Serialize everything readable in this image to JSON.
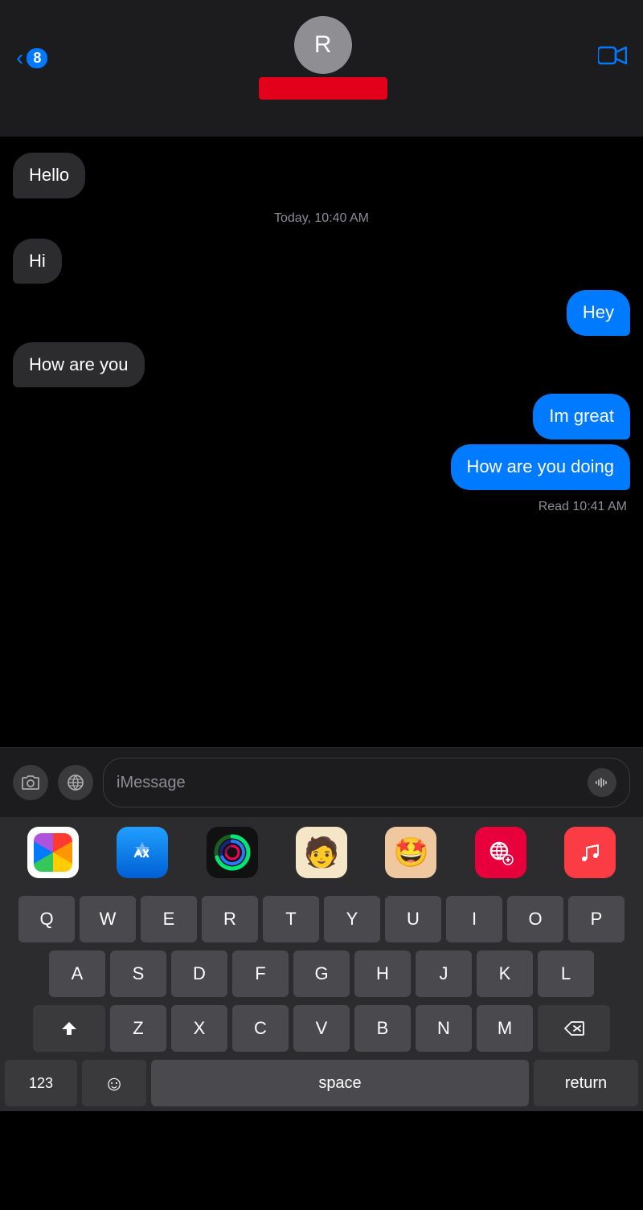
{
  "header": {
    "back_label": "8",
    "avatar_initial": "R",
    "video_call_label": "video-call",
    "contact_name": ""
  },
  "messages": [
    {
      "id": 1,
      "type": "received",
      "text": "Hello"
    },
    {
      "id": 2,
      "type": "timestamp",
      "text": "Today, 10:40 AM"
    },
    {
      "id": 3,
      "type": "received",
      "text": "Hi"
    },
    {
      "id": 4,
      "type": "sent",
      "text": "Hey"
    },
    {
      "id": 5,
      "type": "received",
      "text": "How are you"
    },
    {
      "id": 6,
      "type": "sent",
      "text": "Im great"
    },
    {
      "id": 7,
      "type": "sent",
      "text": "How are you doing"
    },
    {
      "id": 8,
      "type": "read",
      "text": "Read 10:41 AM"
    }
  ],
  "input": {
    "placeholder": "iMessage"
  },
  "keyboard": {
    "rows": [
      [
        "Q",
        "W",
        "E",
        "R",
        "T",
        "Y",
        "U",
        "I",
        "O",
        "P"
      ],
      [
        "A",
        "S",
        "D",
        "F",
        "G",
        "H",
        "J",
        "K",
        "L"
      ],
      [
        "Z",
        "X",
        "C",
        "V",
        "B",
        "N",
        "M"
      ]
    ],
    "space_label": "space",
    "return_label": "return",
    "num_label": "123"
  }
}
